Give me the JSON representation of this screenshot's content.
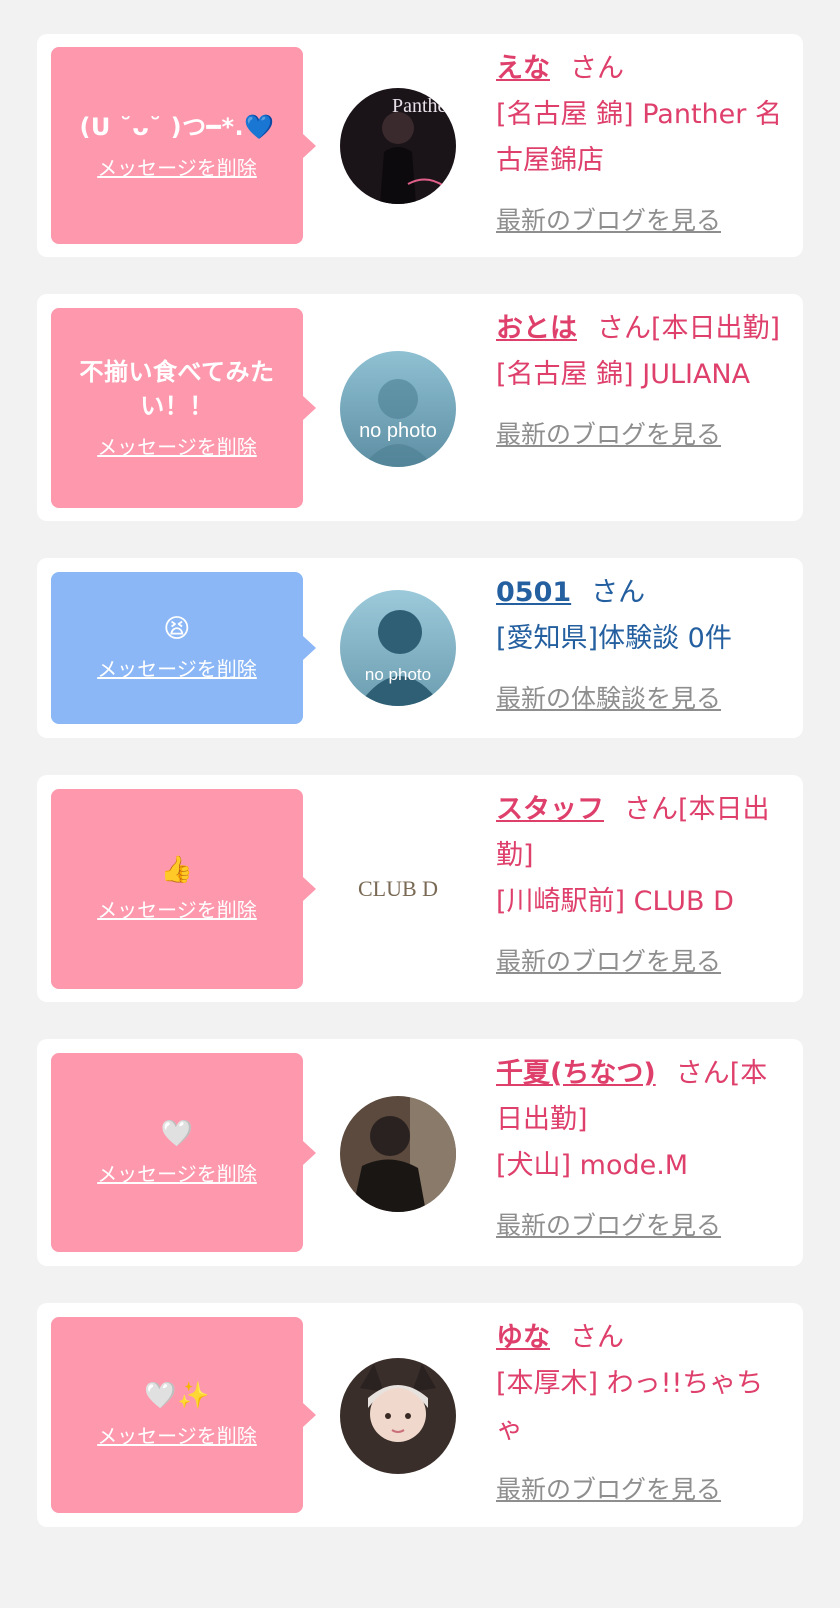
{
  "conversations": [
    {
      "message": "(U ˘ᴗ˘ )つ━*.💙",
      "delete_label": "メッセージを削除",
      "name": "えな",
      "honorific": "さん",
      "status": "",
      "shop": "[名古屋 錦] Panther 名古屋錦店",
      "blog_link": "最新のブログを見る",
      "avatar_text": "Panther"
    },
    {
      "message": "不揃い食べてみたい！！",
      "delete_label": "メッセージを削除",
      "name": "おとは",
      "honorific": "さん",
      "status": "[本日出勤]",
      "shop": "[名古屋 錦] JULIANA",
      "blog_link": "最新のブログを見る",
      "avatar_text": "no photo"
    },
    {
      "message": "😫",
      "delete_label": "メッセージを削除",
      "name": "0501",
      "honorific": "さん",
      "status": "",
      "shop": "[愛知県]体験談 0件",
      "blog_link": "最新の体験談を見る",
      "avatar_text": "no photo"
    },
    {
      "message": "👍",
      "delete_label": "メッセージを削除",
      "name": "スタッフ",
      "honorific": "さん",
      "status": "[本日出勤]",
      "shop": "[川崎駅前] CLUB D",
      "blog_link": "最新のブログを見る",
      "avatar_text": "CLUB D"
    },
    {
      "message": "🤍",
      "delete_label": "メッセージを削除",
      "name": "千夏(ちなつ)",
      "honorific": "さん",
      "status": "[本日出勤]",
      "shop": "[犬山] mode.M",
      "blog_link": "最新のブログを見る",
      "avatar_text": ""
    },
    {
      "message": "🤍✨",
      "delete_label": "メッセージを削除",
      "name": "ゆな",
      "honorific": "さん",
      "status": "",
      "shop": "[本厚木] わっ!!ちゃちゃ",
      "blog_link": "最新のブログを見る",
      "avatar_text": ""
    }
  ],
  "colors": {
    "page_bg": "#f2f2f2",
    "bubble_pink": "#fd98ad",
    "bubble_blue": "#8bb7f6",
    "text_pink": "#de3f6b",
    "text_blue": "#245fa0",
    "link_gray": "#8e8e8e"
  }
}
